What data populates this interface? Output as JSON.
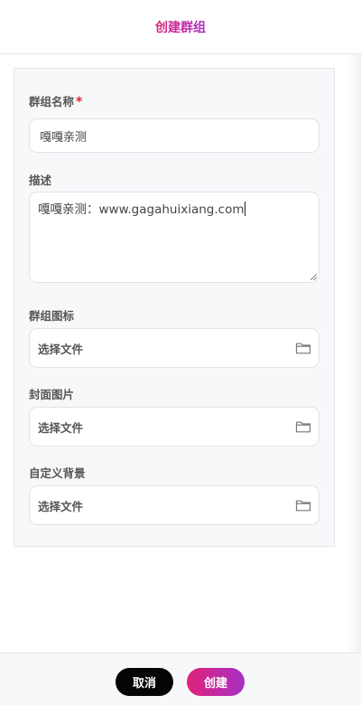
{
  "header": {
    "title": "创建群组"
  },
  "form": {
    "name": {
      "label": "群组名称",
      "required_mark": "*",
      "value": "嘎嘎亲测"
    },
    "description": {
      "label": "描述",
      "value": "嘎嘎亲测：www.gagahuixiang.com"
    },
    "group_icon": {
      "label": "群组图标",
      "button_text": "选择文件"
    },
    "cover_image": {
      "label": "封面图片",
      "button_text": "选择文件"
    },
    "custom_background": {
      "label": "自定义背景",
      "button_text": "选择文件"
    }
  },
  "footer": {
    "cancel_label": "取消",
    "create_label": "创建"
  },
  "colors": {
    "accent_gradient_start": "#e0237a",
    "accent_gradient_end": "#a72fc4",
    "cancel_button": "#050505",
    "required_mark": "#e0202a"
  },
  "icons": [
    "folder-icon",
    "resize-grip-icon"
  ]
}
